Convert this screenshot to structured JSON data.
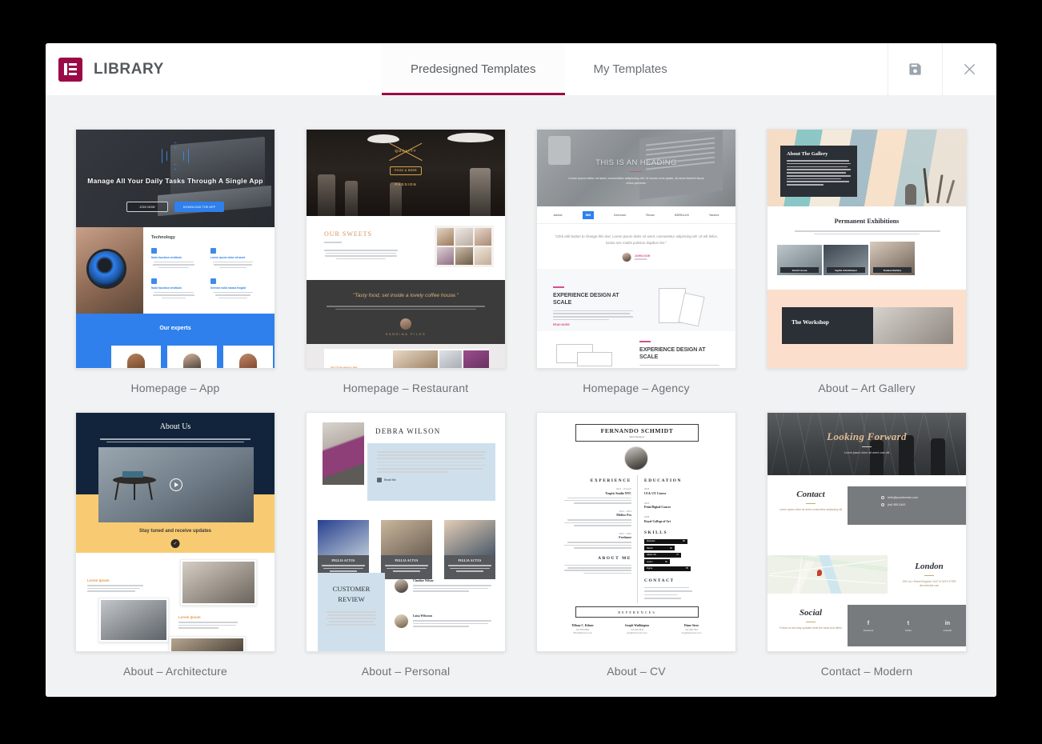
{
  "header": {
    "brand_title": "LIBRARY",
    "logo_icon": "elementor-logo-icon",
    "tabs": [
      {
        "label": "Predesigned Templates",
        "active": true
      },
      {
        "label": "My Templates",
        "active": false
      }
    ],
    "actions": [
      {
        "name": "save-icon",
        "title": "Save"
      },
      {
        "name": "close-icon",
        "title": "Close"
      }
    ],
    "accent_color": "#9b0a46"
  },
  "templates": [
    {
      "caption": "Homepage – App",
      "hero_heading": "Manage All Your Daily Tasks Through A Single App",
      "buttons": [
        "JOIN NOW",
        "DOWNLOAD THE APP"
      ],
      "section_title": "Technology",
      "features": [
        "Nulla faucibus vestibulo",
        "Lorem ipsum dolor sit amet",
        "Nulla faucibus vestibulo",
        "Sernear nulla massa feugiat"
      ],
      "band_title": "Our experts"
    },
    {
      "caption": "Homepage – Restaurant",
      "badge_top": "QUALITY",
      "badge_mid": "FOOD & BEER",
      "badge_bottom": "PASSION",
      "section_title": "OUR SWEETS",
      "quote": "\"Tasty food, set inside a lovely coffee house.\"",
      "quote_author": "SABRINA PILES"
    },
    {
      "caption": "Homepage – Agency",
      "hero_heading": "THIS IS AN HEADING",
      "hero_sub": "Lorem ipsum dolor sit amet, consectetur adipiscing elit. Ut luctus eros quam, sit amet laoreet lacus tellus pulvinar.",
      "logos": [
        "Adobe",
        "IBM",
        "Intercom",
        "Revue",
        "BÜROLUX",
        "Yandex"
      ],
      "quote": "\"Click edit button to change this text. Lorem ipsum dolor sit amet, consectetur adipiscing elit. Ut elit tellus, luctus nec mattis pulvinar dapibus leo.\"",
      "quote_author": "JOHN DOE",
      "section_title_1": "EXPERIENCE DESIGN AT SCALE",
      "section_title_2": "EXPERIENCE DESIGN AT SCALE",
      "cta": "READ MORE"
    },
    {
      "caption": "About – Art Gallery",
      "card_title": "About The Gallery",
      "section_title": "Permanent Exhibitions",
      "artists": [
        "David Carson",
        "Sophie Schnitzbauer",
        "Damian Barkley"
      ],
      "workshop_title": "The Workshop"
    },
    {
      "caption": "About – Architecture",
      "hero_heading": "About Us",
      "hero_sub": "Cras iaculis feugiat interdum. Cras mattis, augue id vestibulum mollis, arcu eros erat, sit amet varius sem ultrices diam nibh. Ut rhoncus lacus id bibendum placerat ante eu vestibulum quis.",
      "band_title": "Stay tuned and receive updates",
      "label_1": "Lorem Ipsum",
      "label_2": "Lorem Ipsum"
    },
    {
      "caption": "About – Personal",
      "name": "DEBRA WILSON",
      "cta": "Email Me",
      "cards": [
        "PIGLIA ACTUS",
        "PIGLIA ACTUS",
        "PIGLIA ACTUS"
      ],
      "review_title": "CUSTOMER REVIEW",
      "reviewers": [
        "Claudine Wilson",
        "Luisa Wilcoxon"
      ]
    },
    {
      "caption": "About – CV",
      "name": "FERNANDO SCHMIDT",
      "role": "Web Designer",
      "headings": [
        "EXPERIENCE",
        "EDUCATION",
        "SKILLS",
        "ABOUT ME",
        "CONTACT"
      ],
      "experience": [
        {
          "date": "2012 – Present",
          "title": "Traptic Studio NYC"
        },
        {
          "date": "2012 – 2011",
          "title": "Mellow Pro"
        },
        {
          "date": "2012 – 2010",
          "title": "Freelance"
        }
      ],
      "education": [
        {
          "date": "2018",
          "title": "UI & UX Course"
        },
        {
          "date": "2015",
          "title": "Print/Digital Course"
        },
        {
          "date": "2008",
          "title": "Royal College of Art"
        }
      ],
      "skills": [
        {
          "name": "Illustrator",
          "value": "80"
        },
        {
          "name": "Sketch",
          "value": "90"
        },
        {
          "name": "Adobe XD",
          "value": "70"
        },
        {
          "name": "Lorem",
          "value": "60"
        },
        {
          "name": "Figma",
          "value": "85"
        }
      ],
      "references_label": "REFERENCES",
      "references": [
        {
          "name": "Tiffany C. Kilmer",
          "phone": "201-555-0892",
          "email": "office@kilmerco.com"
        },
        {
          "name": "Joseph Wadhington",
          "phone": "212-456-0933",
          "email": "josp@theconnect.com"
        },
        {
          "name": "Diane Stroe",
          "phone": "314-388-7811",
          "email": "hey@dianestroe.com"
        }
      ]
    },
    {
      "caption": "Contact – Modern",
      "hero_heading": "Looking Forward",
      "hero_sub": "Lorem ipsum dolor sit amet cras elit",
      "contact_title": "Contact",
      "contact_sub": "Lorem ipsum dolor sit amet consectetur adipiscing elit",
      "contact_items": [
        "hello@yourdomain.com",
        "(tel) 555-3443"
      ],
      "city_title": "London",
      "city_sub": "195 Lov'r Street Kingdom 1447 N 34TH STRE decortrends.com",
      "social_title": "Social",
      "social_sub": "Follow us and stay updated what the news and offers",
      "socials": [
        {
          "glyph": "f",
          "label": "Facebook"
        },
        {
          "glyph": "t",
          "label": "Twitter"
        },
        {
          "glyph": "in",
          "label": "LinkedIn"
        }
      ]
    }
  ]
}
